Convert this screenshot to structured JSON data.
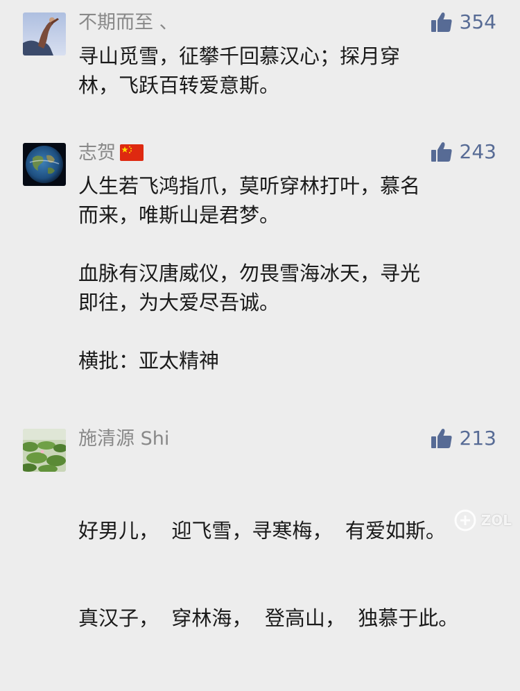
{
  "comments": [
    {
      "name": "不期而至 、",
      "likes": "354",
      "lines": [
        "寻山觅雪，征攀千回慕汉心；探月穿",
        "林，飞跃百转爱意斯。"
      ]
    },
    {
      "name": "志贺",
      "likes": "243",
      "lines": [
        "人生若飞鸿指爪，莫听穿林打叶，慕名",
        "而来，唯斯山是君梦。",
        "",
        "血脉有汉唐威仪，勿畏雪海冰天，寻光",
        "即往，为大爱尽吾诚。",
        "",
        "横批：亚太精神"
      ]
    },
    {
      "name": "施清源 Shi",
      "likes": "213",
      "lines": [
        "好男儿，  迎飞雪，寻寒梅，  有爱如斯。",
        "真汉子，  穿林海，  登高山，  独慕于此。"
      ]
    }
  ],
  "icons": {
    "like": "thumbs-up-icon",
    "flag": "china-flag-icon"
  },
  "colors": {
    "background": "#ededed",
    "link_blue": "#576b95",
    "name_gray": "#888888",
    "text": "#1a1a1a"
  },
  "watermark": "ZOL"
}
